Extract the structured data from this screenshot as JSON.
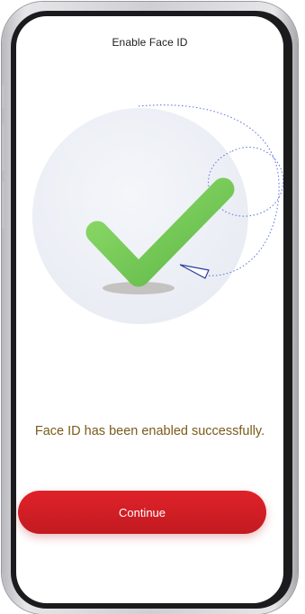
{
  "header": {
    "title": "Enable Face ID"
  },
  "illustration": {
    "icon": "checkmark-icon",
    "check_color": "#7cd05a",
    "circle_color": "#eef1f6",
    "orbit_color": "#5b6ee1"
  },
  "main": {
    "message": "Face ID has been enabled successfully."
  },
  "actions": {
    "continue_label": "Continue",
    "accent_color": "#d41f26"
  }
}
